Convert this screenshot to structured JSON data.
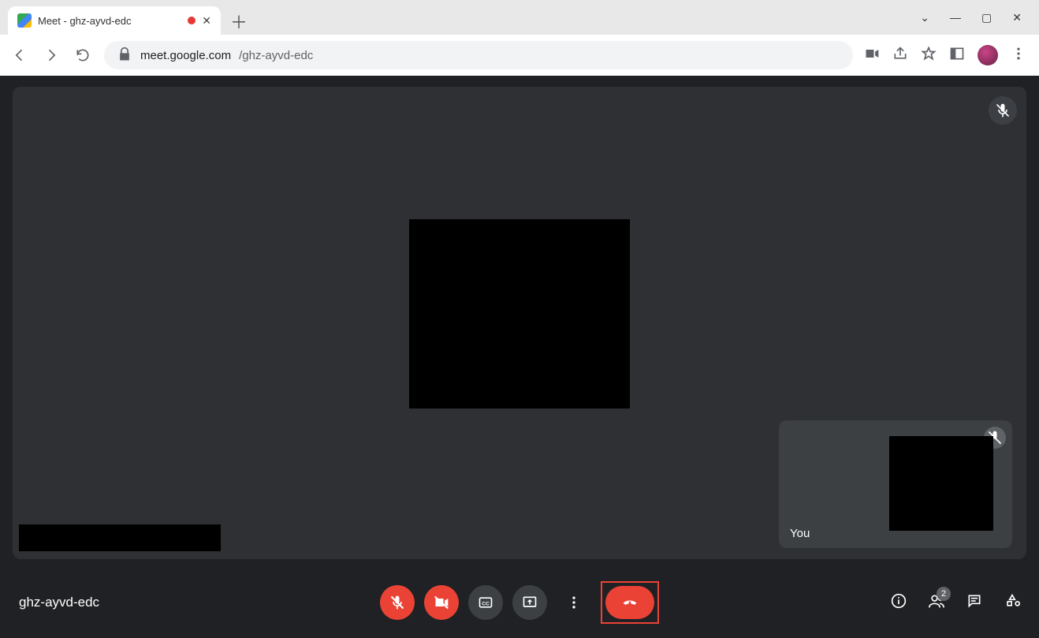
{
  "browser": {
    "tab_title": "Meet - ghz-ayvd-edc",
    "url_host": "meet.google.com",
    "url_path": "/ghz-ayvd-edc"
  },
  "meet": {
    "meeting_code": "ghz-ayvd-edc",
    "self_view_label": "You",
    "participants_badge": "2"
  }
}
